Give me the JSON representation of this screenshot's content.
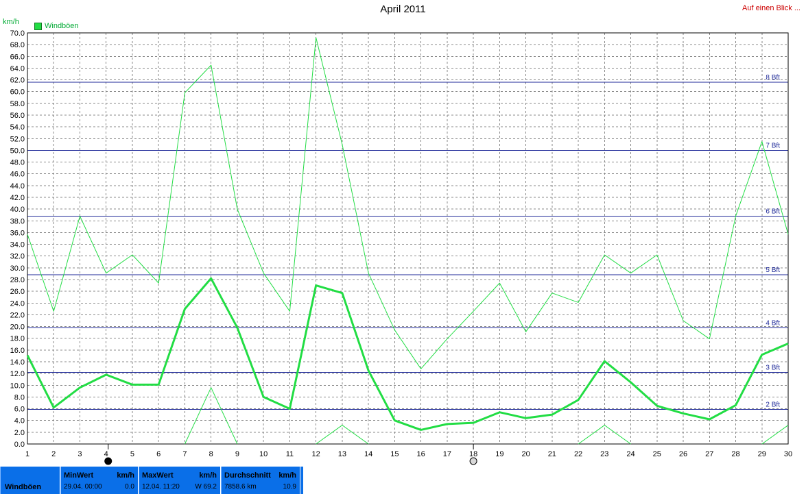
{
  "header": {
    "title": "April 2011",
    "overview_link": "Auf einen Blick ...",
    "unit": "km/h",
    "legend": "Windböen"
  },
  "colors": {
    "series_line": "#22dd44",
    "grid": "#888888",
    "beaufort_line": "#1f2a99",
    "beaufort_text": "#1f2a99",
    "footer_bg": "#0a6fe8"
  },
  "chart_data": {
    "type": "line",
    "x": [
      1,
      2,
      3,
      4,
      5,
      6,
      7,
      8,
      9,
      10,
      11,
      12,
      13,
      14,
      15,
      16,
      17,
      18,
      19,
      20,
      21,
      22,
      23,
      24,
      25,
      26,
      27,
      28,
      29,
      30
    ],
    "ylim": [
      0,
      70
    ],
    "ytick_step": 2,
    "grid": true,
    "series": [
      {
        "name": "Windböen",
        "role": "average",
        "width": "thick",
        "values": [
          15.1,
          6.2,
          9.6,
          11.8,
          10.1,
          10.1,
          23.0,
          28.2,
          19.8,
          8.0,
          6.0,
          27.0,
          25.7,
          12.5,
          4.0,
          2.4,
          3.4,
          3.6,
          5.4,
          4.4,
          5.0,
          7.5,
          14.1,
          10.5,
          6.5,
          5.2,
          4.2,
          6.6,
          15.2,
          17.1
        ]
      },
      {
        "role": "max",
        "width": "thin",
        "values": [
          35.7,
          22.6,
          38.8,
          29.1,
          32.2,
          27.4,
          59.8,
          64.5,
          40.0,
          29.1,
          22.6,
          69.2,
          51.0,
          29.1,
          19.4,
          12.8,
          17.9,
          22.6,
          27.4,
          19.1,
          25.7,
          24.1,
          32.2,
          29.1,
          32.2,
          21.0,
          17.9,
          38.8,
          51.5,
          35.7
        ]
      },
      {
        "role": "min",
        "width": "thin",
        "values": [
          null,
          null,
          null,
          null,
          null,
          null,
          0.0,
          9.6,
          0.0,
          null,
          null,
          0.0,
          3.2,
          0.0,
          null,
          null,
          null,
          null,
          null,
          null,
          null,
          0.0,
          3.2,
          0.0,
          null,
          null,
          null,
          null,
          0.0,
          3.2
        ]
      }
    ],
    "beaufort_lines": [
      {
        "label": "2 Bft",
        "value": 5.9
      },
      {
        "label": "3 Bft",
        "value": 12.2
      },
      {
        "label": "4 Bft",
        "value": 19.8
      },
      {
        "label": "5 Bft",
        "value": 28.8
      },
      {
        "label": "6 Bft",
        "value": 38.8
      },
      {
        "label": "7 Bft",
        "value": 50.0
      },
      {
        "label": "8 Bft",
        "value": 61.6
      }
    ],
    "moon_phases": [
      {
        "day": 4,
        "phase": "new-moon"
      },
      {
        "day": 18,
        "phase": "full-moon"
      }
    ]
  },
  "footer": {
    "series_name": "Windböen",
    "min": {
      "label": "MinWert",
      "unit": "km/h",
      "when": "29.04.  00:00",
      "value": "0.0"
    },
    "max": {
      "label": "MaxWert",
      "unit": "km/h",
      "when": "12.04.  11:20",
      "value": "W 69.2"
    },
    "avg": {
      "label": "Durchschnitt",
      "unit": "km/h",
      "distance": "7858.6 km",
      "value": "10.9"
    }
  }
}
